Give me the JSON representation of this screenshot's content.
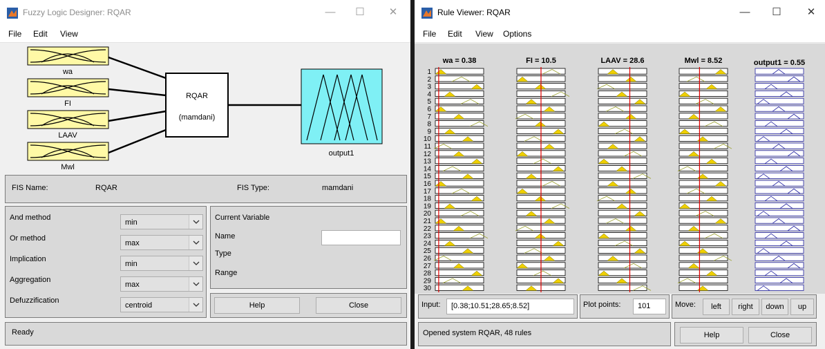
{
  "left_window": {
    "title": "Fuzzy Logic Designer: RQAR",
    "menu": [
      "File",
      "Edit",
      "View"
    ],
    "window_controls": {
      "minimize": "—",
      "maximize": "☐",
      "close": "✕"
    },
    "diagram": {
      "inputs": [
        "wa",
        "FI",
        "LAAV",
        "Mwl"
      ],
      "system_name": "RQAR",
      "system_type_label": "(mamdani)",
      "output": "output1",
      "input_fill": "#fff9a6",
      "output_fill": "#7ff0f5"
    },
    "fis_name_label": "FIS Name:",
    "fis_name": "RQAR",
    "fis_type_label": "FIS Type:",
    "fis_type": "mamdani",
    "methods": [
      {
        "label": "And method",
        "value": "min"
      },
      {
        "label": "Or method",
        "value": "max"
      },
      {
        "label": "Implication",
        "value": "min"
      },
      {
        "label": "Aggregation",
        "value": "max"
      },
      {
        "label": "Defuzzification",
        "value": "centroid"
      }
    ],
    "current_variable": {
      "header": "Current Variable",
      "name_label": "Name",
      "type_label": "Type",
      "range_label": "Range",
      "name_value": ""
    },
    "help_label": "Help",
    "close_label": "Close",
    "status": "Ready"
  },
  "right_window": {
    "title": "Rule Viewer: RQAR",
    "menu": [
      "File",
      "Edit",
      "View",
      "Options"
    ],
    "window_controls": {
      "minimize": "—",
      "maximize": "☐",
      "close": "✕"
    },
    "columns": [
      {
        "header": "wa = 0.38",
        "value": 0.38
      },
      {
        "header": "FI = 10.5",
        "value": 10.5
      },
      {
        "header": "LAAV = 28.6",
        "value": 28.6
      },
      {
        "header": "Mwl = 8.52",
        "value": 8.52
      },
      {
        "header": "output1 = 0.55",
        "value": 0.55
      }
    ],
    "rule_numbers": [
      "1",
      "2",
      "3",
      "4",
      "5",
      "6",
      "7",
      "8",
      "9",
      "10",
      "11",
      "12",
      "13",
      "14",
      "15",
      "16",
      "17",
      "18",
      "19",
      "20",
      "21",
      "22",
      "23",
      "24",
      "25",
      "26",
      "27",
      "28",
      "29",
      "30"
    ],
    "input_label": "Input:",
    "input_value": "[0.38;10.51;28.65;8.52]",
    "plot_points_label": "Plot points:",
    "plot_points_value": "101",
    "move_label": "Move:",
    "move_buttons": [
      "left",
      "right",
      "down",
      "up"
    ],
    "status": "Opened system RQAR, 48 rules",
    "help_label": "Help",
    "close_label": "Close",
    "colors": {
      "input_fill": "#f0d000",
      "output_line": "#1f1f9f",
      "marker_line": "#e00000",
      "mf_line": "#9aa02a"
    }
  }
}
